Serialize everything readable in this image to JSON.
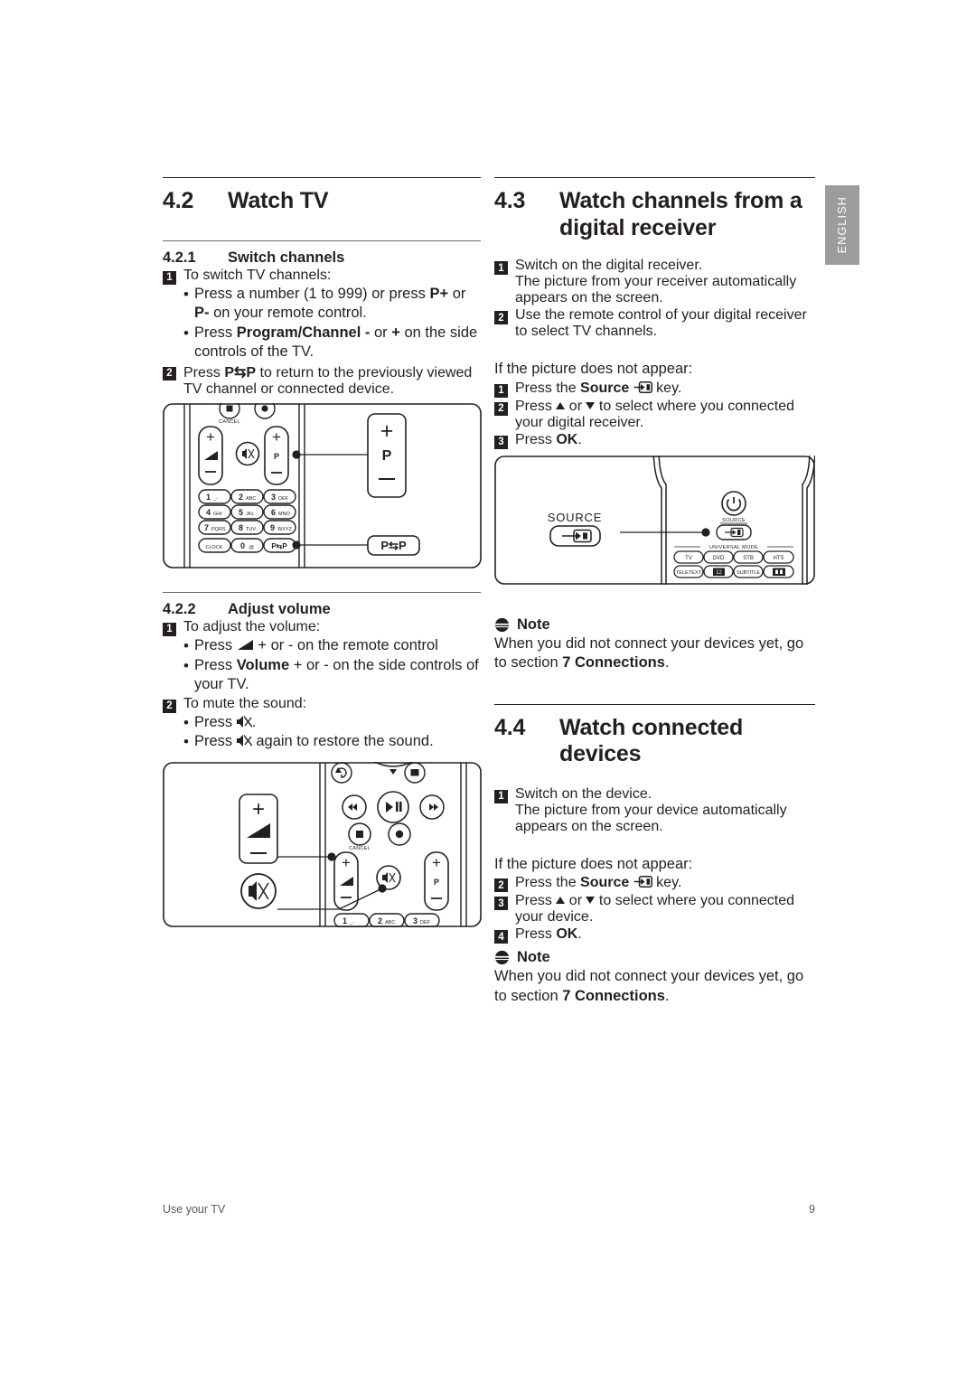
{
  "page": {
    "language_tab": "ENGLISH",
    "footer_left": "Use your TV",
    "footer_page": "9",
    "accent_gray": "#9c9c9c",
    "text_color": "#231f20"
  },
  "sections": {
    "watch_tv": {
      "number": "4.2",
      "title": "Watch TV",
      "sub_switch": {
        "number": "4.2.1",
        "title": "Switch channels",
        "step1": {
          "badge": "1",
          "text": "To switch TV channels:",
          "bullets": [
            {
              "pre": "Press a number (1 to 999) or press ",
              "b1": "P+",
              "mid": " or ",
              "b2": "P-",
              "post": " on your remote control."
            },
            {
              "pre": "Press ",
              "b1": "Program/Channel -",
              "mid": " or ",
              "b2": "+",
              "post": " on the side controls of the TV."
            }
          ]
        },
        "step2": {
          "badge": "2",
          "pre": "Press ",
          "bold": "P⇆P",
          "post": " to return to the previously viewed TV channel or connected device."
        }
      },
      "sub_volume": {
        "number": "4.2.2",
        "title": "Adjust volume",
        "step1": {
          "badge": "1",
          "text": "To adjust the volume:",
          "bullet1_pre": "Press ",
          "bullet1_icon": "volume-icon",
          "bullet1_post": " + or - on the remote control",
          "bullet2_pre": "Press ",
          "bullet2_bold": "Volume",
          "bullet2_post": " + or - on the side controls of your TV."
        },
        "step2": {
          "badge": "2",
          "text": "To mute the sound:",
          "bullet1_pre": "Press ",
          "bullet1_icon": "mute-icon",
          "bullet1_post": ".",
          "bullet2_pre": "Press ",
          "bullet2_icon": "mute-icon",
          "bullet2_post": " again to restore the sound."
        }
      }
    },
    "digital_receiver": {
      "number": "4.3",
      "title_line1": "Watch channels from a",
      "title_line2": "digital receiver",
      "step1": {
        "badge": "1",
        "line1": "Switch on the digital receiver.",
        "line2": "The picture from your receiver automatically appears on the screen."
      },
      "step2": {
        "badge": "2",
        "line1": "Use the remote control of your digital receiver to select TV channels."
      },
      "fallback_intro": "If the picture does not appear:",
      "fallback": [
        {
          "badge": "1",
          "pre": "Press the ",
          "bold": "Source",
          "icon": "source-icon",
          "post": " key."
        },
        {
          "badge": "2",
          "pre": "Press ",
          "icon_up": "triangle-up-icon",
          "mid": " or ",
          "icon_down": "triangle-down-icon",
          "post": " to select where you connected your digital receiver."
        },
        {
          "badge": "3",
          "pre": "Press ",
          "bold": "OK",
          "post": "."
        }
      ],
      "note": {
        "icon": "note-icon",
        "title": "Note",
        "pre": "When you did not connect your devices yet, go to section ",
        "bold": "7 Connections",
        "post": "."
      }
    },
    "connected_devices": {
      "number": "4.4",
      "title": "Watch connected devices",
      "step1": {
        "badge": "1",
        "line1": "Switch on the device.",
        "line2": "The picture from your device automatically appears on the screen."
      },
      "fallback_intro": "If the picture does not appear:",
      "fallback": [
        {
          "badge": "2",
          "pre": "Press the ",
          "bold": "Source",
          "icon": "source-icon",
          "post": " key."
        },
        {
          "badge": "3",
          "pre": "Press ",
          "icon_up": "triangle-up-icon",
          "mid": " or ",
          "icon_down": "triangle-down-icon",
          "post": " to select where you connected your device."
        },
        {
          "badge": "4",
          "pre": "Press ",
          "bold": "OK",
          "post": "."
        }
      ],
      "note": {
        "icon": "note-icon",
        "title": "Note",
        "pre": "When you did not connect your devices yet, go to section ",
        "bold": "7 Connections",
        "post": "."
      }
    }
  },
  "figures": {
    "remote_channel": {
      "name": "remote-channel-figure",
      "cancel_label": "CANCEL",
      "p_label": "P",
      "plus": "+",
      "minus": "−",
      "keypad": [
        {
          "digit": "1",
          "letters": "_-"
        },
        {
          "digit": "2",
          "letters": "ABC"
        },
        {
          "digit": "3",
          "letters": "DEF"
        },
        {
          "digit": "4",
          "letters": "GHI"
        },
        {
          "digit": "5",
          "letters": "JKL"
        },
        {
          "digit": "6",
          "letters": "MNO"
        },
        {
          "digit": "7",
          "letters": "PQRS"
        },
        {
          "digit": "8",
          "letters": "TUV"
        },
        {
          "digit": "9",
          "letters": "WXYZ"
        }
      ],
      "clock_label": "CLOCK",
      "zero_digit": "0",
      "zero_letters": ".@",
      "pp_label": "P⇆P",
      "callout_p": "P",
      "callout_pp": "P⇆P"
    },
    "remote_source": {
      "name": "remote-source-figure",
      "callout_label": "SOURCE",
      "source_label": "SOURCE",
      "universal_mode_label": "UNIVERSAL MODE",
      "mode_buttons": [
        "TV",
        "DVD",
        "STB",
        "HTS"
      ],
      "teletext_label": "TELETEXT",
      "dual_label": "12",
      "subtitle_label": "SUBTITLE",
      "format_label": "format-icon"
    },
    "remote_volume": {
      "name": "remote-volume-figure",
      "cancel_label": "CANCEL",
      "p_label": "P",
      "plus": "+",
      "minus": "−",
      "keypad_row": [
        {
          "digit": "1",
          "letters": "_-"
        },
        {
          "digit": "2",
          "letters": "ABC"
        },
        {
          "digit": "3",
          "letters": "DEF"
        }
      ]
    }
  }
}
